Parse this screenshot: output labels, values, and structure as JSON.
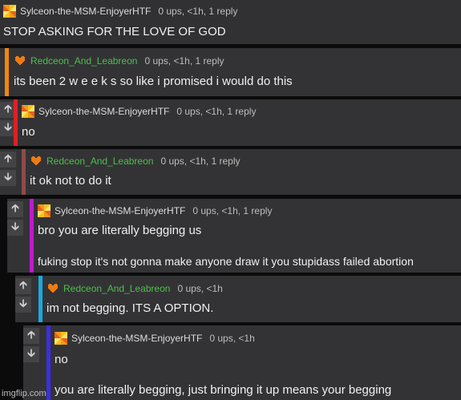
{
  "comments": [
    {
      "user": "Sylceon-the-MSM-EnjoyerHTF",
      "meta": "0 ups, <1h, 1 reply",
      "lines": [
        "STOP ASKING FOR THE LOVE OF GOD"
      ],
      "avatar": "pinwheel-avatar"
    },
    {
      "user": "Redceon_And_Leabreon",
      "meta": "0 ups, <1h, 1 reply",
      "lines": [
        "its been 2 w e e k s so like i promised i would do this"
      ],
      "avatar": "heart-avatar",
      "bar_color": "#f0860c"
    },
    {
      "user": "Sylceon-the-MSM-EnjoyerHTF",
      "meta": "0 ups, <1h, 1 reply",
      "lines": [
        "no"
      ],
      "avatar": "pinwheel-avatar",
      "bar_color": "#e31e25"
    },
    {
      "user": "Redceon_And_Leabreon",
      "meta": "0 ups, <1h, 1 reply",
      "lines": [
        "it ok not to do it"
      ],
      "avatar": "heart-avatar",
      "bar_color": "#8f4a4a"
    },
    {
      "user": "Sylceon-the-MSM-EnjoyerHTF",
      "meta": "0 ups, <1h, 1 reply",
      "lines": [
        "bro you are literally begging us",
        "fuking stop it's not gonna make anyone draw it you stupidass failed abortion"
      ],
      "avatar": "pinwheel-avatar",
      "bar_color": "#c01ad0"
    },
    {
      "user": "Redceon_And_Leabreon",
      "meta": "0 ups, <1h",
      "lines": [
        "im not begging. ITS A OPTION."
      ],
      "avatar": "heart-avatar",
      "bar_color": "#1aa9e0"
    },
    {
      "user": "Sylceon-the-MSM-EnjoyerHTF",
      "meta": "0 ups, <1h",
      "lines": [
        "no",
        "you are literally begging, just bringing it up means your begging"
      ],
      "avatar": "pinwheel-avatar",
      "bar_color": "#3a2ee6"
    }
  ],
  "vote_icons": {
    "up": "up-arrow-icon",
    "down": "down-arrow-icon"
  },
  "watermark": "imgflip.com"
}
